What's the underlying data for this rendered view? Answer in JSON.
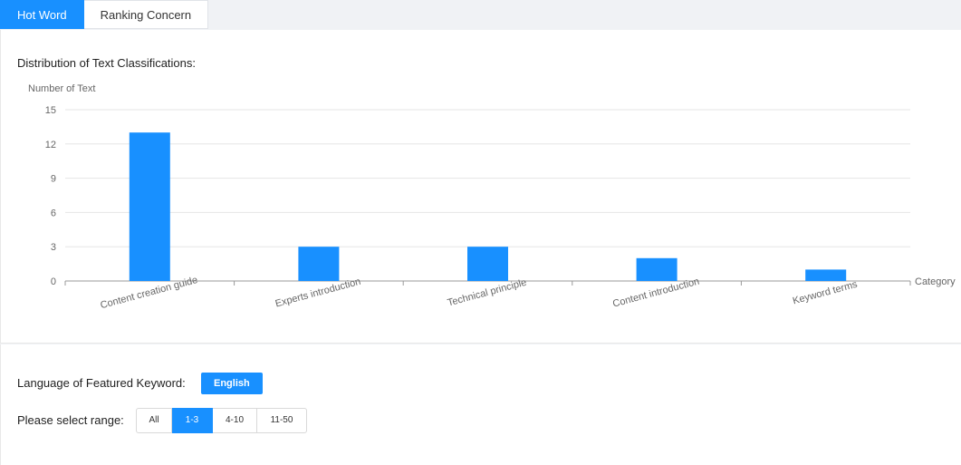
{
  "tabs": [
    {
      "label": "Hot Word",
      "active": true
    },
    {
      "label": "Ranking Concern",
      "active": false
    }
  ],
  "section_title": "Distribution of Text Classifications:",
  "chart_data": {
    "type": "bar",
    "title": "",
    "ylabel": "Number of Text",
    "xlabel": "Category",
    "categories": [
      "Content creation guide",
      "Experts introduction",
      "Technical principle",
      "Content introduction",
      "Keyword terms"
    ],
    "values": [
      13,
      3,
      3,
      2,
      1
    ],
    "ylim": [
      0,
      15
    ],
    "yticks": [
      0,
      3,
      6,
      9,
      12,
      15
    ],
    "grid": true,
    "bar_color": "#1890ff"
  },
  "language": {
    "label": "Language of Featured Keyword:",
    "value": "English"
  },
  "range": {
    "label": "Please select range:",
    "options": [
      "All",
      "1-3",
      "4-10",
      "11-50"
    ],
    "selected": "1-3"
  },
  "colors": {
    "accent": "#1890ff"
  }
}
